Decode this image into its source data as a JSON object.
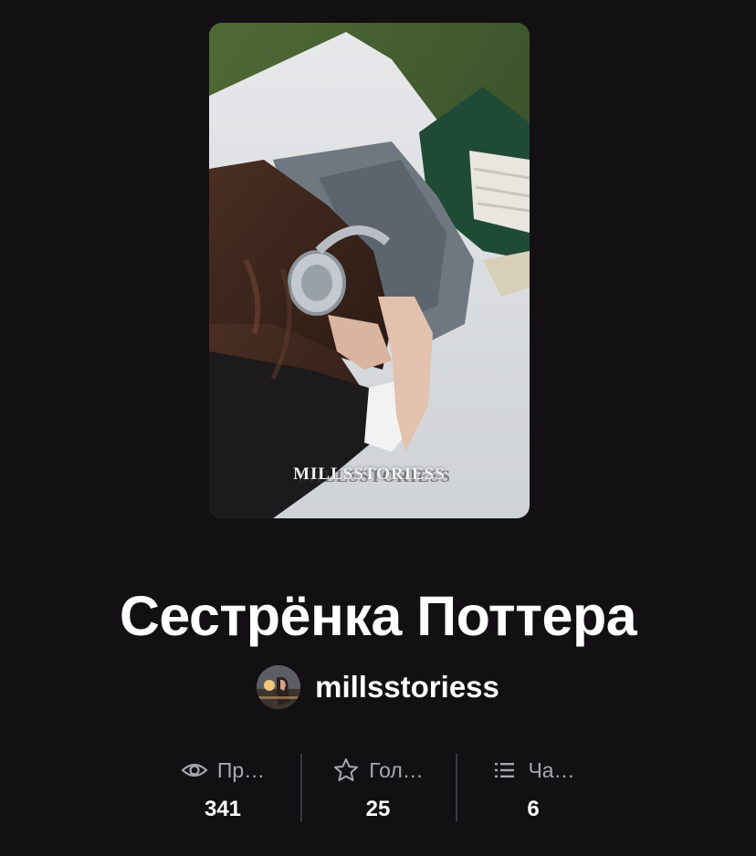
{
  "story": {
    "title": "Сестрёнка Поттера",
    "cover_watermark": "MILLSSTORIESS"
  },
  "author": {
    "username": "millsstoriess"
  },
  "stats": [
    {
      "icon": "eye-icon",
      "label": "Пр…",
      "value": "341"
    },
    {
      "icon": "star-icon",
      "label": "Гол…",
      "value": "25"
    },
    {
      "icon": "list-icon",
      "label": "Ча…",
      "value": "6"
    }
  ],
  "colors": {
    "background": "#121013",
    "text_primary": "#ffffff",
    "text_secondary": "#a9a7ad",
    "divider": "#3b393d"
  }
}
